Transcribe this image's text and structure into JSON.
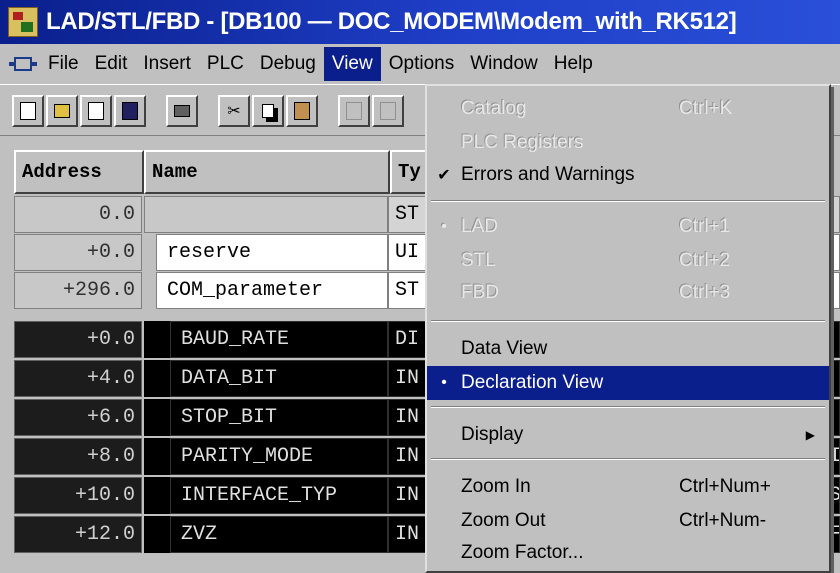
{
  "window": {
    "title": "LAD/STL/FBD  - [DB100 — DOC_MODEM\\Modem_with_RK512]"
  },
  "menu": [
    "File",
    "Edit",
    "Insert",
    "PLC",
    "Debug",
    "View",
    "Options",
    "Window",
    "Help"
  ],
  "table": {
    "headers": {
      "address": "Address",
      "name": "Name",
      "type": "Ty"
    },
    "rows": [
      {
        "address": "0.0",
        "name": "",
        "type": "ST"
      },
      {
        "address": "+0.0",
        "name": "reserve",
        "type": "UI"
      },
      {
        "address": "+296.0",
        "name": "COM_parameter",
        "type": "ST"
      },
      {
        "address": "+0.0",
        "name": "BAUD_RATE",
        "type": "DI"
      },
      {
        "address": "+4.0",
        "name": "DATA_BIT",
        "type": "IN"
      },
      {
        "address": "+6.0",
        "name": "STOP_BIT",
        "type": "IN"
      },
      {
        "address": "+8.0",
        "name": "PARITY_MODE",
        "type": "IN"
      },
      {
        "address": "+10.0",
        "name": "INTERFACE_TYP",
        "type": "IN"
      },
      {
        "address": "+12.0",
        "name": "ZVZ",
        "type": "IN"
      }
    ],
    "right_edge": [
      "",
      "",
      "",
      "",
      "",
      "",
      "I",
      "S",
      "F"
    ]
  },
  "view_menu": {
    "catalog": {
      "label": "Catalog",
      "shortcut": "Ctrl+K"
    },
    "plc_registers": {
      "label": "PLC Registers"
    },
    "errors_warnings": {
      "label": "Errors and Warnings",
      "mark": "✔"
    },
    "lad": {
      "label": "LAD",
      "shortcut": "Ctrl+1",
      "mark": "•"
    },
    "stl": {
      "label": "STL",
      "shortcut": "Ctrl+2"
    },
    "fbd": {
      "label": "FBD",
      "shortcut": "Ctrl+3"
    },
    "data_view": {
      "label": "Data View"
    },
    "declaration_view": {
      "label": "Declaration View",
      "mark": "•"
    },
    "display": {
      "label": "Display",
      "arrow": "▶"
    },
    "zoom_in": {
      "label": "Zoom In",
      "shortcut": "Ctrl+Num+"
    },
    "zoom_out": {
      "label": "Zoom Out",
      "shortcut": "Ctrl+Num-"
    },
    "zoom_factor": {
      "label": "Zoom Factor..."
    }
  }
}
